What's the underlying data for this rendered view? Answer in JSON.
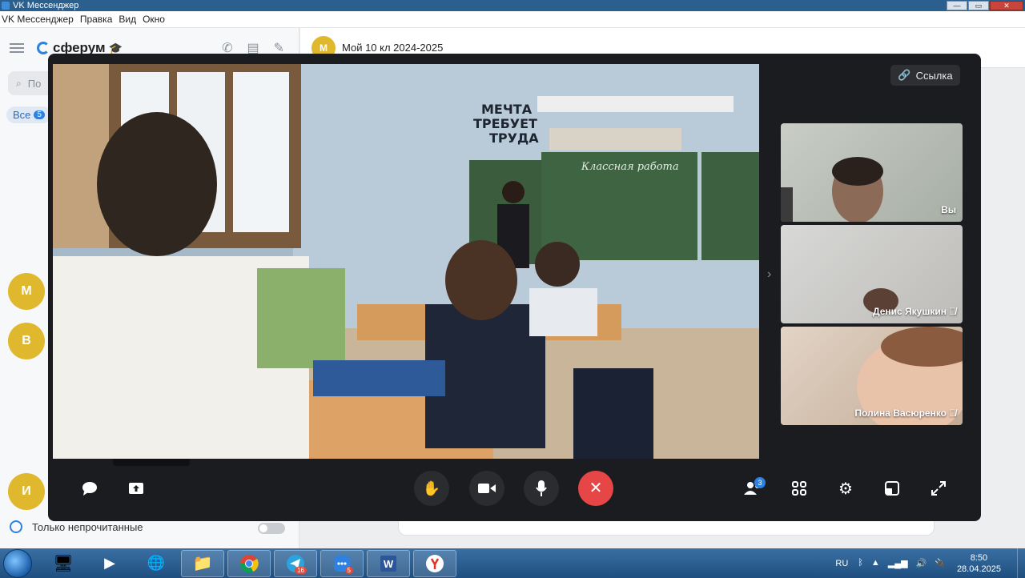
{
  "window": {
    "title": "VK Мессенджер"
  },
  "menu": [
    "VK Мессенджер",
    "Правка",
    "Вид",
    "Окно"
  ],
  "sidebar": {
    "brand": "сферум",
    "search_placeholder": "По",
    "filter_label": "Все",
    "filter_count": "5",
    "avatars": [
      {
        "letter": "М",
        "color": "#e0b82e"
      },
      {
        "letter": "В",
        "color": "#e0b82e"
      },
      {
        "letter": "И",
        "color": "#e0b82e"
      }
    ],
    "unread_only_label": "Только непрочитанные"
  },
  "chat": {
    "avatar_letter": "М",
    "title": "Мой 10 кл 2024-2025"
  },
  "call": {
    "link_button": "Ссылка",
    "participants": [
      {
        "name": "Вы",
        "muted": false
      },
      {
        "name": "Денис Якушкин",
        "muted": true
      },
      {
        "name": "Полина Васюренко",
        "muted": true
      }
    ],
    "participants_count": "3",
    "classroom_text": {
      "slogan_1": "МЕЧТА",
      "slogan_2": "ТРЕБУЕТ",
      "slogan_3": "ТРУДА",
      "board": "Классная работа"
    }
  },
  "taskbar": {
    "lang": "RU",
    "time": "8:50",
    "date": "28.04.2025",
    "telegram_badge": "16",
    "vk_badge": "5"
  },
  "colors": {
    "call_bg": "#1b1c1f",
    "end_call": "#e64646",
    "accent": "#2d81e0"
  }
}
